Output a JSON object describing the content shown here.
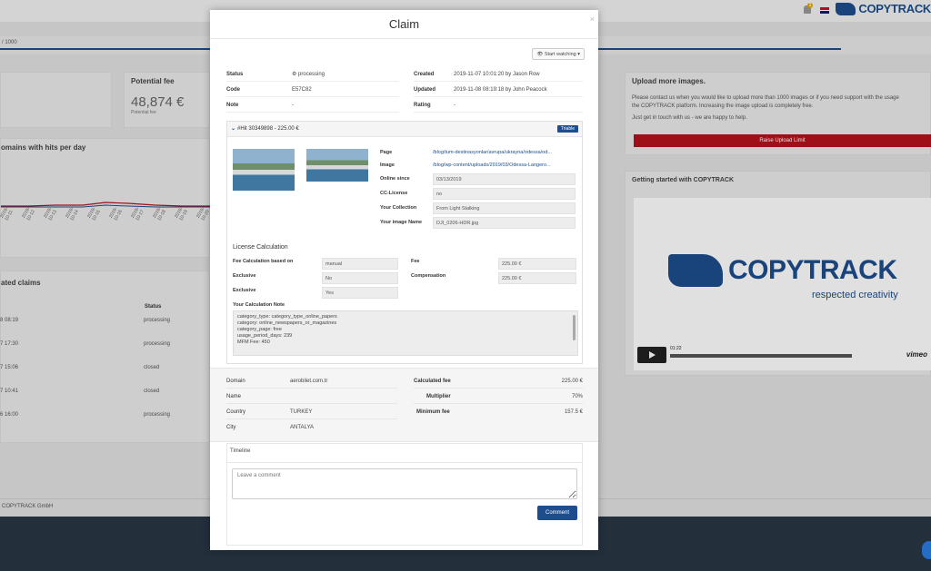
{
  "brand": {
    "name": "COPYTRACK",
    "tagline": "respected creativity"
  },
  "header": {
    "notification_count": "1"
  },
  "background": {
    "progress_text": "/ 1000",
    "potential_fee": {
      "title": "Potential fee",
      "value": "48,874 €",
      "sub": "Potential fee"
    },
    "domains_chart": {
      "title": "omains with hits per day",
      "ticks": [
        "2019-10-11",
        "2019-10-12",
        "2019-10-13",
        "2019-10-14",
        "2019-10-15",
        "2019-10-16",
        "2019-10-17",
        "2019-10-18",
        "2019-10-19",
        "2019-10-20"
      ]
    },
    "claims": {
      "title": "ated claims",
      "status_header": "Status",
      "rows": [
        {
          "date": "8 08:19",
          "status": "processing"
        },
        {
          "date": "7 17:30",
          "status": "processing"
        },
        {
          "date": "7 15:06",
          "status": "closed"
        },
        {
          "date": "7 10:41",
          "status": "closed"
        },
        {
          "date": "6 16:00",
          "status": "processing"
        }
      ]
    },
    "upload": {
      "title": "Upload more images.",
      "text1": "Please contact us when you would like to upload more than 1000 images or if you need support with the usage",
      "text2": "the COPYTRACK platform. Increasing the image upload is completely free.",
      "text3": "Just get in touch with us - we are happy to help.",
      "button": "Raise Upload Limit"
    },
    "getting_started": {
      "title": "Getting started with COPYTRACK",
      "time": "01:22",
      "player": "vimeo"
    },
    "footer": "COPYTRACK GmbH"
  },
  "modal": {
    "title": "Claim",
    "close": "×",
    "watch_button": "Start watching",
    "info": {
      "status_label": "Status",
      "status_value": "processing",
      "code_label": "Code",
      "code_value": "E57C82",
      "note_label": "Note",
      "note_value": "-",
      "created_label": "Created",
      "created_value": "2019-11-07 10:01:20 by Jason Row",
      "updated_label": "Updated",
      "updated_value": "2019-11-08 08:19:18 by John Peacock",
      "rating_label": "Rating",
      "rating_value": "-"
    },
    "hit": {
      "title": "#Hit 30349898 - 225.00 €",
      "badge": "Triable",
      "props": [
        {
          "label": "Page",
          "value": "/blog/tum-destinasyonlar/avrupa/ukrayna/odessa/od..."
        },
        {
          "label": "Image",
          "value": "/blog/wp-content/uploads/2019/03/Odessa-Langero..."
        },
        {
          "label": "Online since",
          "value": "03/13/2019"
        },
        {
          "label": "CC-License",
          "value": "no"
        },
        {
          "label": "Your Collection",
          "value": "From Light Stalking"
        },
        {
          "label": "Your image Name",
          "value": "DJI_0206-HDR.jpg"
        }
      ],
      "license": {
        "title": "License Calculation",
        "fee_based_label": "Fee Calculation based on",
        "fee_based_value": "manual",
        "exclusive1_label": "Exclusive",
        "exclusive1_value": "No",
        "exclusive2_label": "Exclusive",
        "exclusive2_value": "Yes",
        "fee_label": "Fee",
        "fee_value": "225.00 €",
        "comp_label": "Compensation",
        "comp_value": "225.00 €",
        "note_label": "Your Calculation Note",
        "note_lines": [
          "category_type: category_type_online_papers",
          "category: online_newspapers_or_magazines",
          "category_page: free",
          "usage_period_days: 239",
          "MFM Fee: 450"
        ]
      }
    },
    "domain": {
      "domain_label": "Domain",
      "domain_value": "aerobilet.com.tr",
      "name_label": "Name",
      "name_value": "",
      "country_label": "Country",
      "country_value": "TURKEY",
      "city_label": "City",
      "city_value": "ANTALYA",
      "calc_fee_label": "Calculated fee",
      "calc_fee_value": "225.00 €",
      "multiplier_label": "Multiplier",
      "multiplier_value": "70%",
      "min_fee_label": "Minimum fee",
      "min_fee_value": "157.5 €"
    },
    "timeline": {
      "title": "Timeline",
      "placeholder": "Leave a comment",
      "button": "Comment"
    }
  }
}
